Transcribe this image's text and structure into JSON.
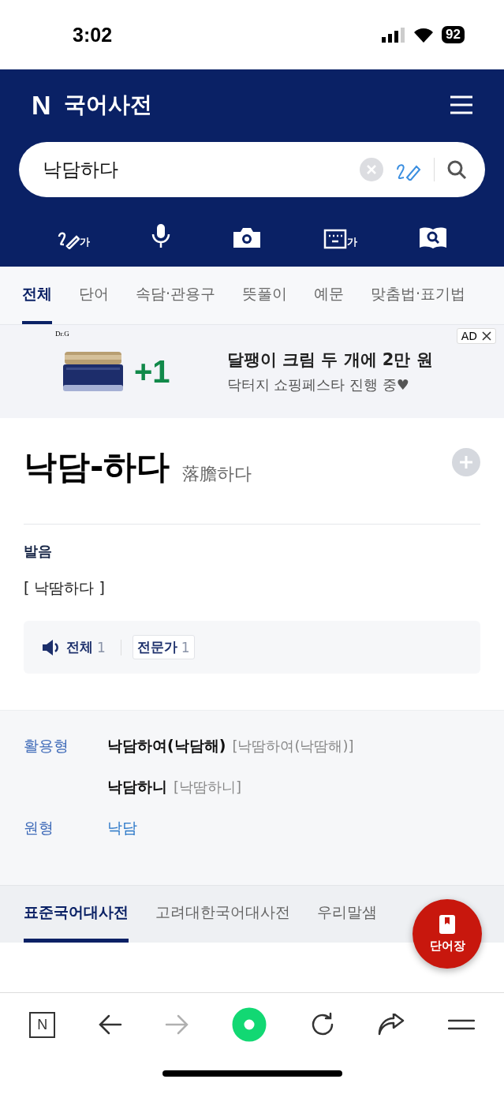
{
  "status_bar": {
    "time": "3:02",
    "battery": "92"
  },
  "header": {
    "logo": "N",
    "title": "국어사전"
  },
  "search": {
    "value": "낙담하다"
  },
  "tools": [
    {
      "kind": "handwrite",
      "label": "가"
    },
    {
      "kind": "voice"
    },
    {
      "kind": "camera"
    },
    {
      "kind": "keyboard",
      "label": "가"
    },
    {
      "kind": "book"
    }
  ],
  "tabs": [
    {
      "label": "전체",
      "selected": true
    },
    {
      "label": "단어",
      "selected": false
    },
    {
      "label": "속담·관용구",
      "selected": false
    },
    {
      "label": "뜻풀이",
      "selected": false
    },
    {
      "label": "예문",
      "selected": false
    },
    {
      "label": "맞춤법·표기법",
      "selected": false
    }
  ],
  "ad": {
    "brand": "Dr.G",
    "promo": "+1",
    "headline": "달팽이 크림 두 개에 2만 원",
    "subline": "닥터지 쇼핑페스타 진행 중♥",
    "badge": "AD"
  },
  "entry": {
    "word": "낙담-하다",
    "hanja": "落膽하다",
    "pronunciation_label": "발음",
    "pronunciation": "[ 낙땀하다 ]",
    "audio": [
      {
        "label": "전체",
        "count": "1",
        "boxed": false
      },
      {
        "label": "전문가",
        "count": "1",
        "boxed": true
      }
    ]
  },
  "forms": [
    {
      "label": "활용형",
      "word": "낙담하여(낙담해)",
      "reading": "[낙땀하여(낙땀해)]",
      "link": false
    },
    {
      "word": "낙담하니",
      "reading": "[낙땀하니]",
      "link": false
    },
    {
      "label": "원형",
      "word": "낙담",
      "link": true
    }
  ],
  "dict_tabs": [
    {
      "label": "표준국어대사전",
      "selected": true
    },
    {
      "label": "고려대한국어대사전",
      "selected": false
    },
    {
      "label": "우리말샘",
      "selected": false
    }
  ],
  "fab": {
    "label": "단어장"
  },
  "bottom_nav": [
    {
      "kind": "home",
      "label": "N",
      "disabled": false
    },
    {
      "kind": "back",
      "disabled": false
    },
    {
      "kind": "forward",
      "disabled": true
    },
    {
      "kind": "green",
      "disabled": false
    },
    {
      "kind": "reload",
      "disabled": false
    },
    {
      "kind": "share",
      "disabled": false
    },
    {
      "kind": "menu",
      "disabled": false
    }
  ]
}
